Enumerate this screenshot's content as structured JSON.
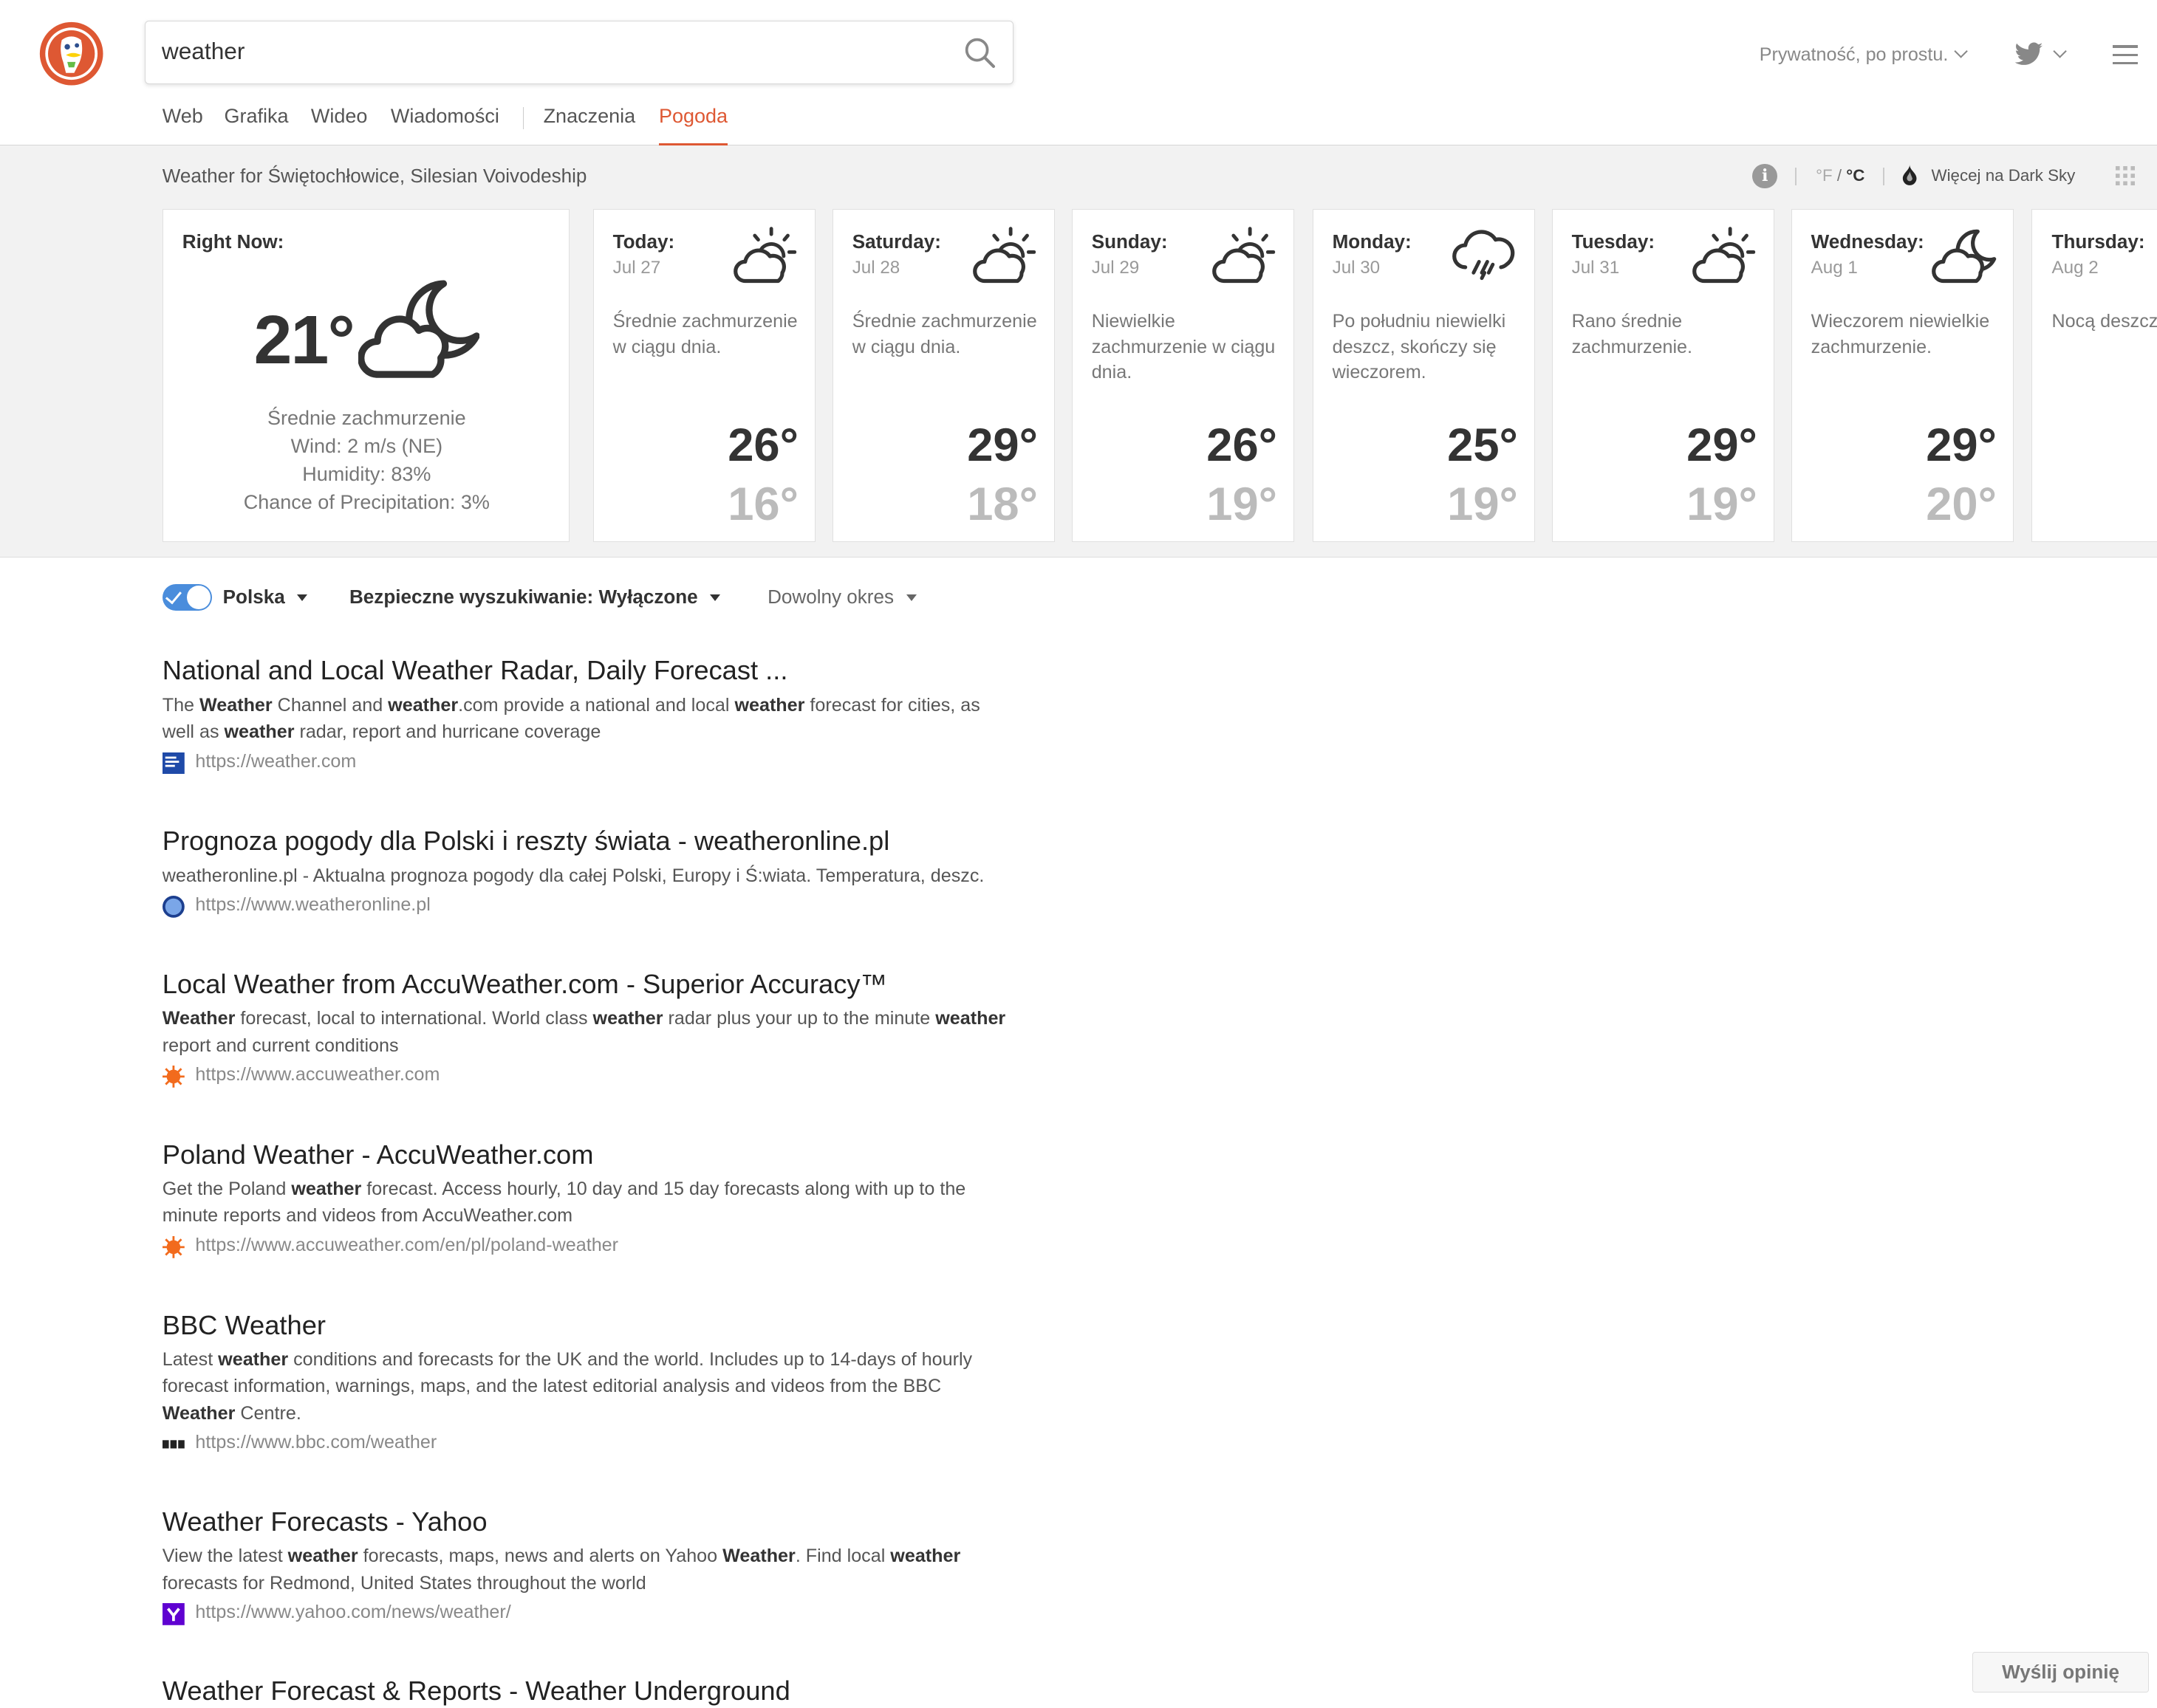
{
  "search": {
    "query": "weather"
  },
  "nav": {
    "tabs": [
      {
        "label": "Web"
      },
      {
        "label": "Grafika"
      },
      {
        "label": "Wideo"
      },
      {
        "label": "Wiadomości"
      },
      {
        "label": "Znaczenia"
      },
      {
        "label": "Pogoda"
      }
    ],
    "active_tab": "Pogoda"
  },
  "header": {
    "privacy_label": "Prywatność, po prostu."
  },
  "weather": {
    "location": "Weather for Świętochłowice, Silesian Voivodeship",
    "unit_f": "°F",
    "unit_sep": " / ",
    "unit_c": "°C",
    "darksky_link": "Więcej na Dark Sky",
    "now": {
      "title": "Right Now:",
      "temp": "21°",
      "icon": "partly-cloudy-night-icon",
      "summary": "Średnie zachmurzenie",
      "wind": "Wind: 2 m/s (NE)",
      "humidity": "Humidity: 83%",
      "precip": "Chance of Precipitation: 3%"
    },
    "days": [
      {
        "name": "Today:",
        "date": "Jul 27",
        "icon": "partly-cloudy-day-icon",
        "summary": "Średnie zachmurzenie w ciągu dnia.",
        "high": "26°",
        "low": "16°"
      },
      {
        "name": "Saturday:",
        "date": "Jul 28",
        "icon": "partly-cloudy-day-icon",
        "summary": "Średnie zachmurzenie w ciągu dnia.",
        "high": "29°",
        "low": "18°"
      },
      {
        "name": "Sunday:",
        "date": "Jul 29",
        "icon": "partly-cloudy-day-icon",
        "summary": "Niewielkie zachmurzenie w ciągu dnia.",
        "high": "26°",
        "low": "19°"
      },
      {
        "name": "Monday:",
        "date": "Jul 30",
        "icon": "rain-icon",
        "summary": "Po południu niewielki deszcz, skończy się wieczorem.",
        "high": "25°",
        "low": "19°"
      },
      {
        "name": "Tuesday:",
        "date": "Jul 31",
        "icon": "partly-cloudy-day-icon",
        "summary": "Rano średnie zachmurzenie.",
        "high": "29°",
        "low": "19°"
      },
      {
        "name": "Wednesday:",
        "date": "Aug 1",
        "icon": "partly-cloudy-night-icon",
        "summary": "Wieczorem niewielkie zachmurzenie.",
        "high": "29°",
        "low": "20°"
      },
      {
        "name": "Thursday:",
        "date": "Aug 2",
        "icon": "partly-cloudy-night-icon",
        "summary": "Nocą deszcz",
        "high": "",
        "low": ""
      }
    ]
  },
  "filters": {
    "region_label": "Polska",
    "safe_search_label": "Bezpieczne wyszukiwanie: Wyłączone",
    "time_label": "Dowolny okres",
    "region_enabled": true
  },
  "results": [
    {
      "title": "National and Local Weather Radar, Daily Forecast ...",
      "snippet": [
        {
          "t": "The "
        },
        {
          "t": "Weather",
          "b": true
        },
        {
          "t": " Channel and "
        },
        {
          "t": "weather",
          "b": true
        },
        {
          "t": ".com provide a national and local "
        },
        {
          "t": "weather",
          "b": true
        },
        {
          "t": " forecast for cities, as well as "
        },
        {
          "t": "weather",
          "b": true
        },
        {
          "t": " radar, report and hurricane coverage"
        }
      ],
      "url": "https://weather.com",
      "favicon": "weather-channel-icon",
      "favicon_color": "#1f4aa8"
    },
    {
      "title": "Prognoza pogody dla Polski i reszty świata - weatheronline.pl",
      "snippet": [
        {
          "t": "weatheronline.pl - Aktualna prognoza pogody dla całej Polski, Europy i Ś:wiata. Temperatura, deszc."
        }
      ],
      "url": "https://www.weatheronline.pl",
      "favicon": "weatheronline-icon",
      "favicon_color": "#1c3f8f"
    },
    {
      "title": "Local Weather from AccuWeather.com - Superior Accuracy™",
      "snippet": [
        {
          "t": "Weather",
          "b": true
        },
        {
          "t": " forecast, local to international. World class "
        },
        {
          "t": "weather",
          "b": true
        },
        {
          "t": " radar plus your up to the minute "
        },
        {
          "t": "weather",
          "b": true
        },
        {
          "t": " report and current conditions"
        }
      ],
      "url": "https://www.accuweather.com",
      "favicon": "accuweather-icon",
      "favicon_color": "#f26b1d"
    },
    {
      "title": "Poland Weather - AccuWeather.com",
      "snippet": [
        {
          "t": "Get the Poland "
        },
        {
          "t": "weather",
          "b": true
        },
        {
          "t": " forecast. Access hourly, 10 day and 15 day forecasts along with up to the minute reports and videos from AccuWeather.com"
        }
      ],
      "url": "https://www.accuweather.com/en/pl/poland-weather",
      "favicon": "accuweather-icon",
      "favicon_color": "#f26b1d"
    },
    {
      "title": "BBC Weather",
      "snippet": [
        {
          "t": "Latest "
        },
        {
          "t": "weather",
          "b": true
        },
        {
          "t": " conditions and forecasts for the UK and the world. Includes up to 14-days of hourly forecast information, warnings, maps, and the latest editorial analysis and videos from the BBC "
        },
        {
          "t": "Weather",
          "b": true
        },
        {
          "t": " Centre."
        }
      ],
      "url": "https://www.bbc.com/weather",
      "favicon": "bbc-icon",
      "favicon_color": "#222222"
    },
    {
      "title": "Weather Forecasts - Yahoo",
      "snippet": [
        {
          "t": "View the latest "
        },
        {
          "t": "weather",
          "b": true
        },
        {
          "t": " forecasts, maps, news and alerts on Yahoo "
        },
        {
          "t": "Weather",
          "b": true
        },
        {
          "t": ". Find local "
        },
        {
          "t": "weather",
          "b": true
        },
        {
          "t": " forecasts for Redmond, United States throughout the world"
        }
      ],
      "url": "https://www.yahoo.com/news/weather/",
      "favicon": "yahoo-icon",
      "favicon_color": "#5f01d1"
    },
    {
      "title": "Weather Forecast & Reports - Weather Underground",
      "snippet": [],
      "url": "",
      "favicon": "",
      "favicon_color": ""
    }
  ],
  "feedback_label": "Wyślij opinię",
  "colors": {
    "accent": "#de5833",
    "toggle": "#4a8ddc",
    "panel_bg": "#f2f2f2"
  }
}
